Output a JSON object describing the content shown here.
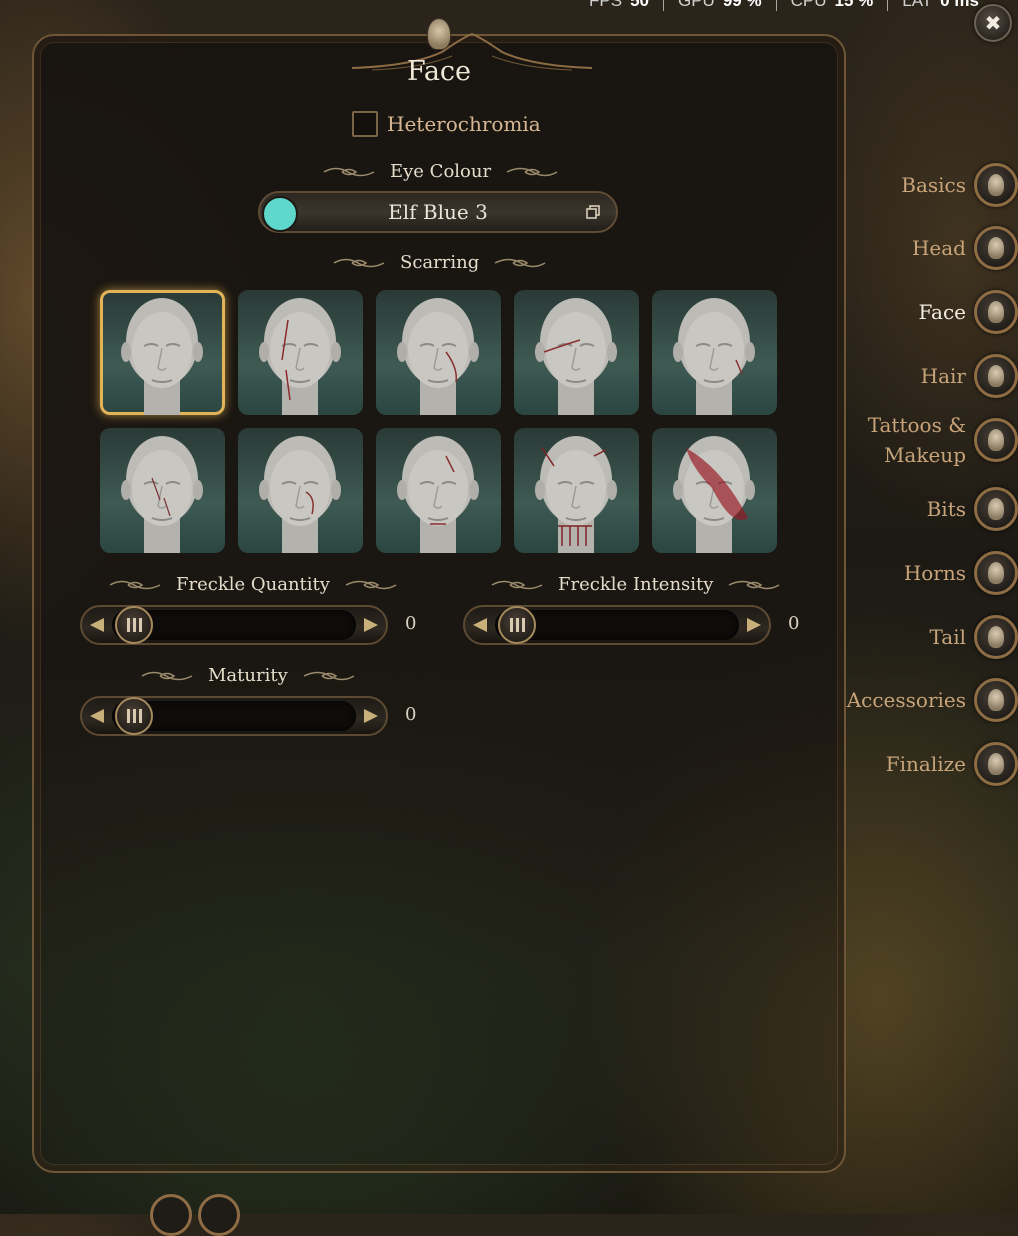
{
  "hud": {
    "fps_label": "FPS",
    "fps_value": "50",
    "gpu_label": "GPU",
    "gpu_value": "99 %",
    "cpu_label": "CPU",
    "cpu_value": "15 %",
    "lat_label": "LAT",
    "lat_value": "0 ms"
  },
  "close_glyph": "✖",
  "panel": {
    "title": "Face",
    "heterochromia_label": "Heterochromia",
    "eye_colour_label": "Eye Colour",
    "eye_colour_value": "Elf Blue 3",
    "eye_colour_swatch": "#5ed8cb",
    "scarring_label": "Scarring",
    "scar_selected_index": 0,
    "freckle_quantity_label": "Freckle Quantity",
    "freckle_quantity_value": "0",
    "freckle_intensity_label": "Freckle Intensity",
    "freckle_intensity_value": "0",
    "maturity_label": "Maturity",
    "maturity_value": "0"
  },
  "nav": {
    "items": [
      {
        "label": "Basics"
      },
      {
        "label": "Head"
      },
      {
        "label": "Face",
        "active": true
      },
      {
        "label": "Hair"
      },
      {
        "label": "Tattoos &",
        "label2": "Makeup"
      },
      {
        "label": "Bits"
      },
      {
        "label": "Horns"
      },
      {
        "label": "Tail"
      },
      {
        "label": "Accessories"
      },
      {
        "label": "Finalize"
      }
    ]
  },
  "colors": {
    "accent_gold": "#e2b357",
    "text_gold": "#c8a47a",
    "frame": "#6e5637"
  }
}
